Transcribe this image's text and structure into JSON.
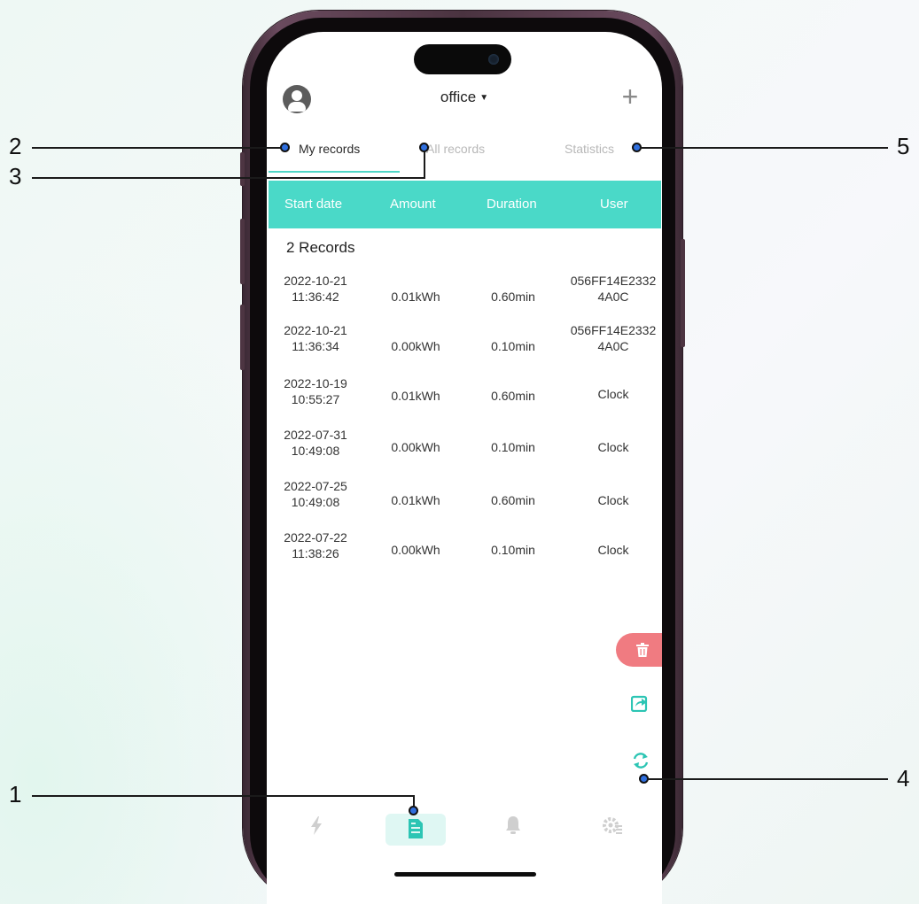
{
  "header": {
    "site_name": "office",
    "add_symbol": "+"
  },
  "tabs": {
    "my_records": "My records",
    "all_records": "All records",
    "statistics": "Statistics"
  },
  "table": {
    "columns": [
      "Start date",
      "Amount",
      "Duration",
      "User"
    ],
    "records_count": "2 Records",
    "rows": [
      {
        "date": "2022-10-21",
        "time": "11:36:42",
        "amount": "0.01kWh",
        "duration": "0.60min",
        "user_line1": "056FF14E2332",
        "user_line2": "4A0C"
      },
      {
        "date": "2022-10-21",
        "time": "11:36:34",
        "amount": "0.00kWh",
        "duration": "0.10min",
        "user_line1": "056FF14E2332",
        "user_line2": "4A0C"
      },
      {
        "date": "2022-10-19",
        "time": "10:55:27",
        "amount": "0.01kWh",
        "duration": "0.60min",
        "user_line1": "Clock",
        "user_line2": ""
      },
      {
        "date": "2022-07-31",
        "time": "10:49:08",
        "amount": "0.00kWh",
        "duration": "0.10min",
        "user_line1": "Clock",
        "user_line2": ""
      },
      {
        "date": "2022-07-25",
        "time": "10:49:08",
        "amount": "0.01kWh",
        "duration": "0.60min",
        "user_line1": "Clock",
        "user_line2": ""
      },
      {
        "date": "2022-07-22",
        "time": "11:38:26",
        "amount": "0.00kWh",
        "duration": "0.10min",
        "user_line1": "Clock",
        "user_line2": ""
      }
    ]
  },
  "actions": {
    "delete_icon": "trash-icon",
    "share_icon": "share-icon",
    "refresh_icon": "refresh-icon"
  },
  "bottom_nav": {
    "items": [
      "charge-icon",
      "records-icon",
      "notification-icon",
      "settings-icon"
    ],
    "active_index": 1
  },
  "callouts": {
    "n1": "1",
    "n2": "2",
    "n3": "3",
    "n4": "4",
    "n5": "5"
  },
  "colors": {
    "accent": "#4ad9c8",
    "delete": "#f07b81",
    "phone_frame": "#4a3340"
  }
}
